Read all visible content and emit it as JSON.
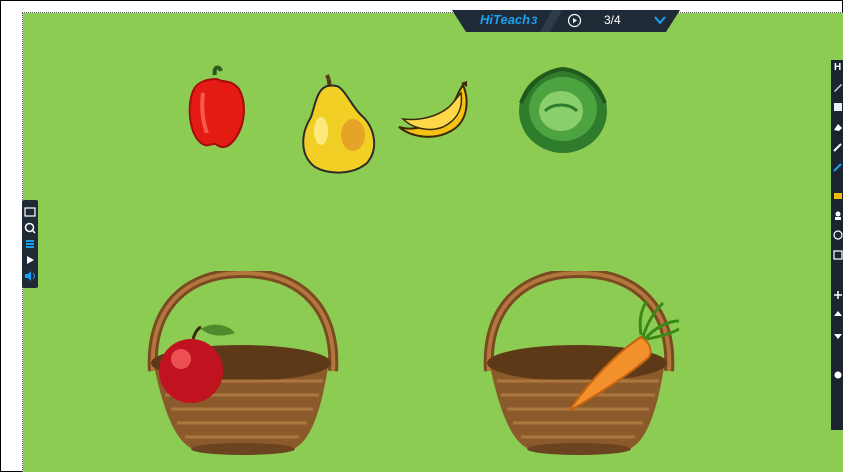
{
  "window": {
    "background_color": "#8ccc52",
    "toolbar_color": "#1e2a36",
    "accent_color": "#1aa1f0"
  },
  "topbar": {
    "brand": "HiTeach",
    "brand_suffix": "3",
    "page_indicator": "3/4",
    "timer_icon": "timer-icon",
    "expand_icon": "chevron-down-icon"
  },
  "left_toolbar": {
    "icons": [
      "screen-icon",
      "search-icon",
      "list-icon",
      "play-icon",
      "sound-icon"
    ]
  },
  "right_toolbar": {
    "label": "H",
    "icons": [
      "pen-icon",
      "highlighter-icon",
      "eraser-icon",
      "select-icon",
      "stamp-icon",
      "timer-icon",
      "picker-icon",
      "zoom-icon",
      "add-icon",
      "up-icon",
      "down-icon",
      "delete-icon",
      "settings-icon"
    ]
  },
  "items": {
    "fruits": [
      "red-pepper",
      "pear",
      "banana",
      "cabbage"
    ],
    "baskets": [
      "basket-with-apple",
      "basket-with-carrot"
    ]
  }
}
